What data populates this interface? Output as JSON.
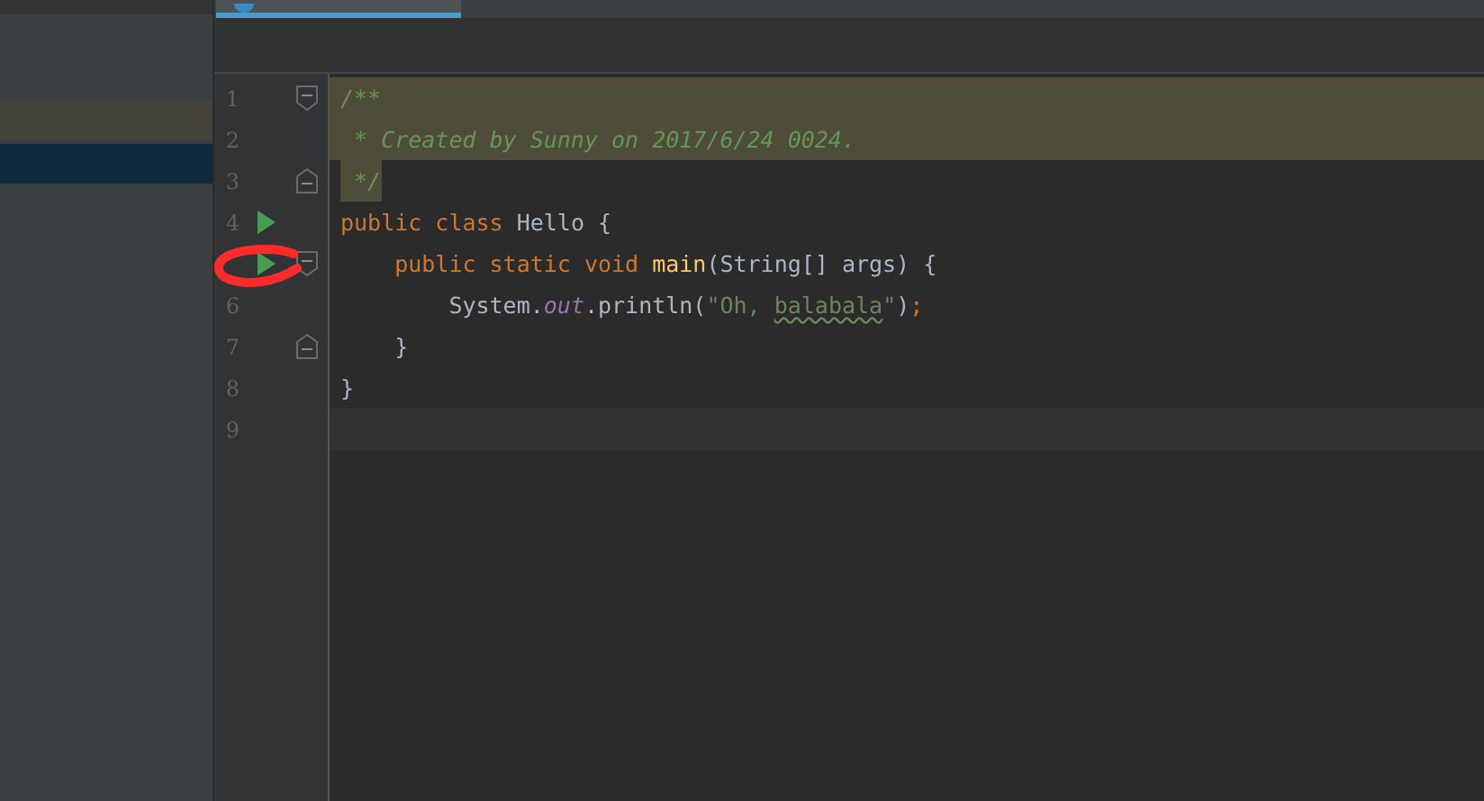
{
  "sidebar": {
    "rows": [
      {
        "selected": false
      },
      {
        "selected": true
      }
    ]
  },
  "editor": {
    "tab": {
      "selected": true
    },
    "lines": [
      {
        "number": "1",
        "run": false,
        "fold_open": true,
        "fold_close": false,
        "current": false,
        "tokens": [
          {
            "kind": "comment",
            "text": "/**"
          }
        ]
      },
      {
        "number": "2",
        "run": false,
        "fold_open": false,
        "fold_close": false,
        "current": false,
        "tokens": [
          {
            "kind": "comment",
            "text": " * Created by Sunny on 2017/6/24 0024."
          }
        ]
      },
      {
        "number": "3",
        "run": false,
        "fold_open": false,
        "fold_close": true,
        "current": false,
        "tokens": [
          {
            "kind": "comment",
            "text": " */"
          }
        ]
      },
      {
        "number": "4",
        "run": true,
        "fold_open": false,
        "fold_close": false,
        "current": false,
        "tokens": [
          {
            "kind": "keyword",
            "text": "public class "
          },
          {
            "kind": "plain",
            "text": "Hello {"
          }
        ]
      },
      {
        "run": true,
        "fold_open": true,
        "fold_close": false,
        "current": false,
        "tokens": [
          {
            "kind": "keyword",
            "text": "    public static void "
          },
          {
            "kind": "method",
            "text": "main"
          },
          {
            "kind": "plain",
            "text": "(String[] args) {"
          }
        ]
      },
      {
        "number": "6",
        "run": false,
        "fold_open": false,
        "fold_close": false,
        "current": false,
        "tokens": [
          {
            "kind": "plain",
            "text": "        System."
          },
          {
            "kind": "field",
            "text": "out"
          },
          {
            "kind": "plain",
            "text": ".println("
          },
          {
            "kind": "string",
            "text": "\"Oh, "
          },
          {
            "kind": "typo",
            "text": "balabala"
          },
          {
            "kind": "string",
            "text": "\""
          },
          {
            "kind": "plain",
            "text": ")"
          },
          {
            "kind": "keyword",
            "text": ";"
          }
        ]
      },
      {
        "number": "7",
        "run": false,
        "fold_open": false,
        "fold_close": true,
        "current": false,
        "tokens": [
          {
            "kind": "plain",
            "text": "    }"
          }
        ]
      },
      {
        "number": "8",
        "run": false,
        "fold_open": false,
        "fold_close": false,
        "current": false,
        "tokens": [
          {
            "kind": "plain",
            "text": "}"
          }
        ]
      },
      {
        "number": "9",
        "run": false,
        "fold_open": false,
        "fold_close": false,
        "current": true
      }
    ]
  }
}
